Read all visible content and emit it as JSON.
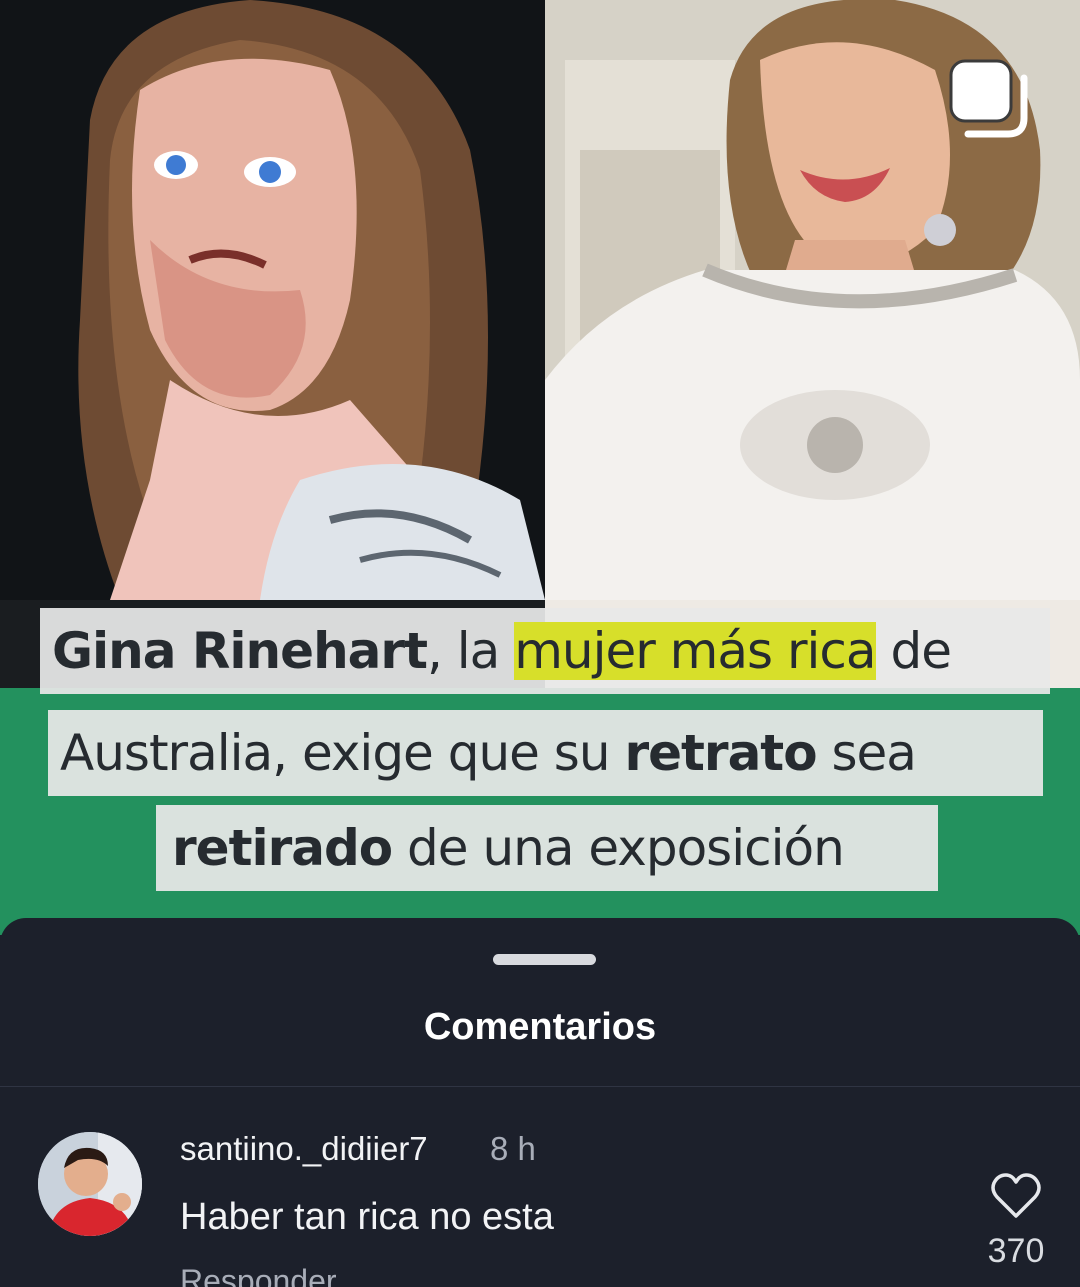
{
  "post": {
    "headline": {
      "line1_a": "Gina Rinehart",
      "line1_b": ", la ",
      "line1_highlight": "mujer más rica",
      "line1_c": " de",
      "line2_a": "Australia, exige que su ",
      "line2_bold": "retrato",
      "line2_b": " sea",
      "line3_bold": "retirado",
      "line3_a": " de una exposición"
    },
    "multi_icon": "carousel-icon",
    "colors": {
      "banner_green": "#23915e",
      "highlight": "#d7df2a"
    }
  },
  "comments_sheet": {
    "title": "Comentarios",
    "comments": [
      {
        "username": "santiino._didiier7",
        "time": "8 h",
        "text": "Haber tan rica no esta",
        "reply_label": "Responder",
        "like_icon": "heart-icon",
        "likes": "370"
      }
    ]
  }
}
